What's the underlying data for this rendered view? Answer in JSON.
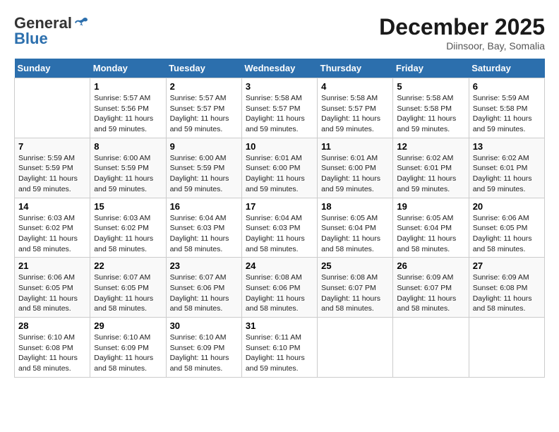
{
  "header": {
    "logo_general": "General",
    "logo_blue": "Blue",
    "month_title": "December 2025",
    "location": "Diinsoor, Bay, Somalia"
  },
  "weekdays": [
    "Sunday",
    "Monday",
    "Tuesday",
    "Wednesday",
    "Thursday",
    "Friday",
    "Saturday"
  ],
  "weeks": [
    [
      {
        "day": "",
        "info": ""
      },
      {
        "day": "1",
        "sunrise": "5:57 AM",
        "sunset": "5:56 PM",
        "daylight": "11 hours and 59 minutes."
      },
      {
        "day": "2",
        "sunrise": "5:57 AM",
        "sunset": "5:57 PM",
        "daylight": "11 hours and 59 minutes."
      },
      {
        "day": "3",
        "sunrise": "5:58 AM",
        "sunset": "5:57 PM",
        "daylight": "11 hours and 59 minutes."
      },
      {
        "day": "4",
        "sunrise": "5:58 AM",
        "sunset": "5:57 PM",
        "daylight": "11 hours and 59 minutes."
      },
      {
        "day": "5",
        "sunrise": "5:58 AM",
        "sunset": "5:58 PM",
        "daylight": "11 hours and 59 minutes."
      },
      {
        "day": "6",
        "sunrise": "5:59 AM",
        "sunset": "5:58 PM",
        "daylight": "11 hours and 59 minutes."
      }
    ],
    [
      {
        "day": "7",
        "sunrise": "5:59 AM",
        "sunset": "5:59 PM",
        "daylight": "11 hours and 59 minutes."
      },
      {
        "day": "8",
        "sunrise": "6:00 AM",
        "sunset": "5:59 PM",
        "daylight": "11 hours and 59 minutes."
      },
      {
        "day": "9",
        "sunrise": "6:00 AM",
        "sunset": "5:59 PM",
        "daylight": "11 hours and 59 minutes."
      },
      {
        "day": "10",
        "sunrise": "6:01 AM",
        "sunset": "6:00 PM",
        "daylight": "11 hours and 59 minutes."
      },
      {
        "day": "11",
        "sunrise": "6:01 AM",
        "sunset": "6:00 PM",
        "daylight": "11 hours and 59 minutes."
      },
      {
        "day": "12",
        "sunrise": "6:02 AM",
        "sunset": "6:01 PM",
        "daylight": "11 hours and 59 minutes."
      },
      {
        "day": "13",
        "sunrise": "6:02 AM",
        "sunset": "6:01 PM",
        "daylight": "11 hours and 59 minutes."
      }
    ],
    [
      {
        "day": "14",
        "sunrise": "6:03 AM",
        "sunset": "6:02 PM",
        "daylight": "11 hours and 58 minutes."
      },
      {
        "day": "15",
        "sunrise": "6:03 AM",
        "sunset": "6:02 PM",
        "daylight": "11 hours and 58 minutes."
      },
      {
        "day": "16",
        "sunrise": "6:04 AM",
        "sunset": "6:03 PM",
        "daylight": "11 hours and 58 minutes."
      },
      {
        "day": "17",
        "sunrise": "6:04 AM",
        "sunset": "6:03 PM",
        "daylight": "11 hours and 58 minutes."
      },
      {
        "day": "18",
        "sunrise": "6:05 AM",
        "sunset": "6:04 PM",
        "daylight": "11 hours and 58 minutes."
      },
      {
        "day": "19",
        "sunrise": "6:05 AM",
        "sunset": "6:04 PM",
        "daylight": "11 hours and 58 minutes."
      },
      {
        "day": "20",
        "sunrise": "6:06 AM",
        "sunset": "6:05 PM",
        "daylight": "11 hours and 58 minutes."
      }
    ],
    [
      {
        "day": "21",
        "sunrise": "6:06 AM",
        "sunset": "6:05 PM",
        "daylight": "11 hours and 58 minutes."
      },
      {
        "day": "22",
        "sunrise": "6:07 AM",
        "sunset": "6:05 PM",
        "daylight": "11 hours and 58 minutes."
      },
      {
        "day": "23",
        "sunrise": "6:07 AM",
        "sunset": "6:06 PM",
        "daylight": "11 hours and 58 minutes."
      },
      {
        "day": "24",
        "sunrise": "6:08 AM",
        "sunset": "6:06 PM",
        "daylight": "11 hours and 58 minutes."
      },
      {
        "day": "25",
        "sunrise": "6:08 AM",
        "sunset": "6:07 PM",
        "daylight": "11 hours and 58 minutes."
      },
      {
        "day": "26",
        "sunrise": "6:09 AM",
        "sunset": "6:07 PM",
        "daylight": "11 hours and 58 minutes."
      },
      {
        "day": "27",
        "sunrise": "6:09 AM",
        "sunset": "6:08 PM",
        "daylight": "11 hours and 58 minutes."
      }
    ],
    [
      {
        "day": "28",
        "sunrise": "6:10 AM",
        "sunset": "6:08 PM",
        "daylight": "11 hours and 58 minutes."
      },
      {
        "day": "29",
        "sunrise": "6:10 AM",
        "sunset": "6:09 PM",
        "daylight": "11 hours and 58 minutes."
      },
      {
        "day": "30",
        "sunrise": "6:10 AM",
        "sunset": "6:09 PM",
        "daylight": "11 hours and 58 minutes."
      },
      {
        "day": "31",
        "sunrise": "6:11 AM",
        "sunset": "6:10 PM",
        "daylight": "11 hours and 59 minutes."
      },
      {
        "day": "",
        "info": ""
      },
      {
        "day": "",
        "info": ""
      },
      {
        "day": "",
        "info": ""
      }
    ]
  ],
  "labels": {
    "sunrise": "Sunrise:",
    "sunset": "Sunset:",
    "daylight": "Daylight:"
  }
}
